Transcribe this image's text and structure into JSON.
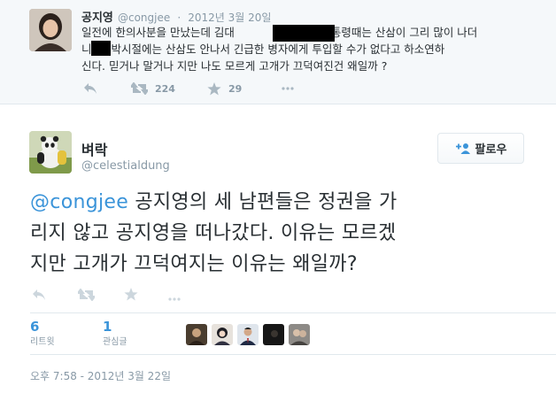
{
  "parent_tweet": {
    "display_name": "공지영",
    "handle": "@congjee",
    "separator": "·",
    "timestamp": "2012년 3월 20일",
    "text_lines": [
      "일전에 한의사분을 만났는데 김대",
      "현 대통령때는 산삼이 그리 많이 나더",
      "니",
      "박시절에는 산삼도 안나서 긴급한 병자에게 투입할 수가 없다고 하소연하",
      "신다. 믿거나 말거나 지만 나도 모르게 고개가 끄덕여진건 왜일까 ?"
    ],
    "retweet_count": "224",
    "favorite_count": "29"
  },
  "main_tweet": {
    "display_name": "벼락",
    "handle": "@celestialdung",
    "follow_label": "팔로우",
    "mention": "@congjee",
    "text_line1_rest": " 공지영의 세 남편들은 정권을 가",
    "text_line2": "리지 않고 공지영을 떠나갔다. 이유는 모르겠",
    "text_line3": "지만 고개가 끄덕여지는 이유는 왜일까?",
    "retweets": {
      "count": "6",
      "label": "리트윗"
    },
    "favorites": {
      "count": "1",
      "label": "관심글"
    },
    "timestamp": "오후 7:58 - 2012년 3월 22일"
  },
  "icons": [
    "reply-icon",
    "retweet-icon",
    "star-icon",
    "add-user-icon"
  ],
  "colors": {
    "link": "#3b94d9",
    "muted": "#8899a6",
    "icon": "#aab8c2",
    "parent_bg": "#f5f8fa"
  }
}
